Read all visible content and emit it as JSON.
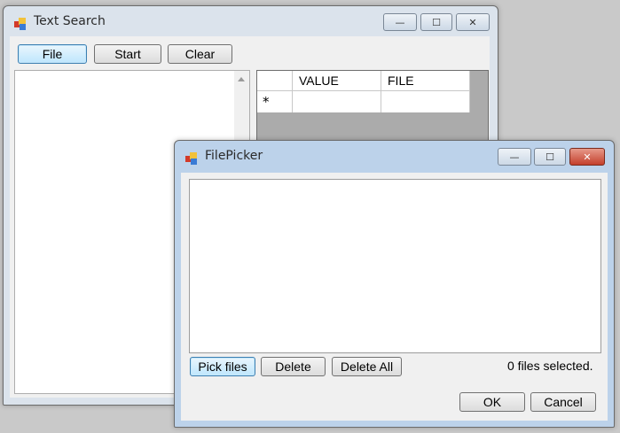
{
  "text_search": {
    "title": "Text Search",
    "buttons": {
      "file": "File",
      "start": "Start",
      "clear": "Clear"
    },
    "grid": {
      "columns": [
        "VALUE",
        "FILE"
      ],
      "new_row_marker": "*"
    }
  },
  "file_picker": {
    "title": "FilePicker",
    "buttons": {
      "pick_files": "Pick files",
      "delete": "Delete",
      "delete_all": "Delete All",
      "ok": "OK",
      "cancel": "Cancel"
    },
    "status": "0 files selected."
  },
  "caption_glyphs": {
    "minimize": "—",
    "maximize": "☐",
    "close": "✕"
  }
}
